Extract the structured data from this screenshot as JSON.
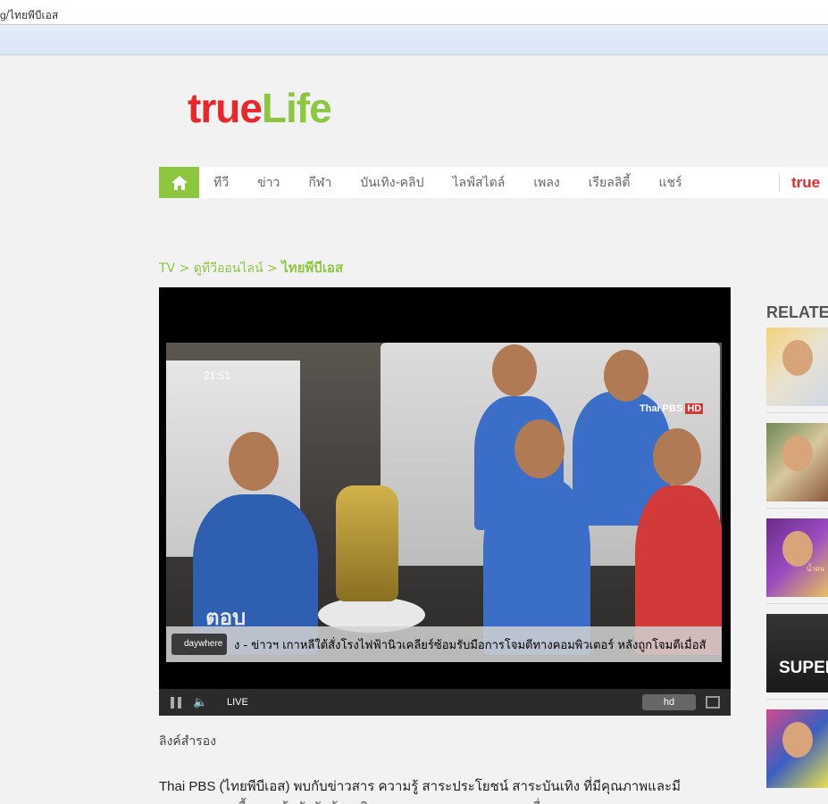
{
  "browser": {
    "address": "g/ไทยพีบีเอส"
  },
  "logo": {
    "part1": "true",
    "part2": "Life"
  },
  "nav": {
    "items": [
      "ทีวี",
      "ข่าว",
      "กีฬา",
      "บันเทิง-คลิป",
      "ไลฟ์สไตล์",
      "เพลง",
      "เรียลลิตี้",
      "แชร์"
    ],
    "brand": "true"
  },
  "breadcrumb": {
    "l1": "TV",
    "sep": " > ",
    "l2": "ดูทีวีออนไลน์",
    "current": "ไทยพีบีเอส"
  },
  "player": {
    "clock": "21:51",
    "channel": "Thai PBS",
    "channel_hd": "HD",
    "bug": "ตอบ",
    "ticker_logo": "daywhere",
    "ticker": "ง - ข่าวฯ เกาหลีใต้สั่งโรงไฟฟ้านิวเคลียร์ซ้อมรับมือการโจมตีทางคอมพิวเตอร์ หลังถูกโจมตีเมื่อสั",
    "live_label": "LIVE",
    "hd_label": "hd"
  },
  "alt_link": "ลิงค์สำรอง",
  "description": "Thai PBS (ไทยพีบีเอส) พบกับข่าวสาร ความรู้ สาระประโยชน์ สาระบันเทิง ที่มีคุณภาพและมี",
  "description_cont": "มาตรฐาน บนพื้นฐานข้อบังคับด้วยจริยธรรม และจรรยาบรรณของสื่อ",
  "related": {
    "title": "RELATE",
    "thumbs": [
      {
        "name": "related-1"
      },
      {
        "name": "related-2"
      },
      {
        "name": "related-3",
        "caption": "น้ำฝน"
      },
      {
        "name": "related-4",
        "caption": "SUPER S"
      },
      {
        "name": "related-5"
      }
    ]
  },
  "colors": {
    "brand_green": "#8dc63f",
    "brand_red": "#e8262b"
  }
}
